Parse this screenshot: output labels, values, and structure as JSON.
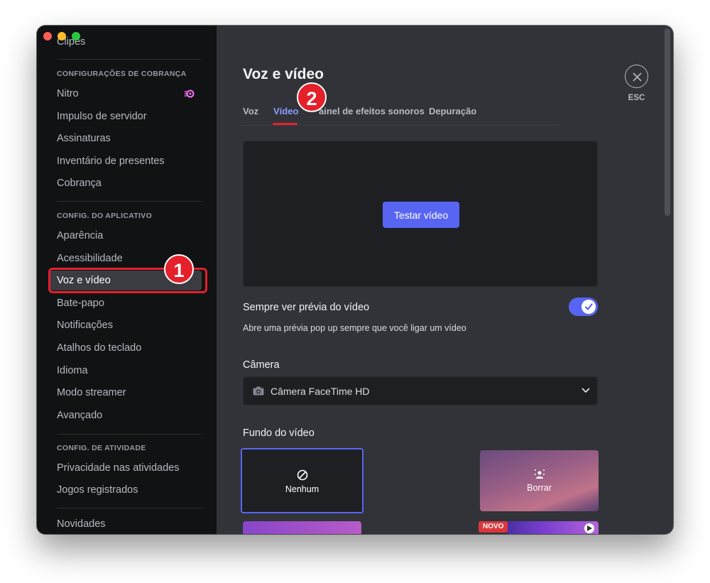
{
  "sidebar": {
    "top_item": "Clipes",
    "sections": [
      {
        "header": "CONFIGURAÇÕES DE COBRANÇA",
        "items": [
          "Nitro",
          "Impulso de servidor",
          "Assinaturas",
          "Inventário de presentes",
          "Cobrança"
        ]
      },
      {
        "header": "CONFIG. DO APLICATIVO",
        "items": [
          "Aparência",
          "Acessibilidade",
          "Voz e vídeo",
          "Bate-papo",
          "Notificações",
          "Atalhos do teclado",
          "Idioma",
          "Modo streamer",
          "Avançado"
        ]
      },
      {
        "header": "CONFIG. DE ATIVIDADE",
        "items": [
          "Privacidade nas atividades",
          "Jogos registrados"
        ]
      }
    ],
    "bottom_item": "Novidades",
    "active_item": "Voz e vídeo"
  },
  "annotations": {
    "step1": "1",
    "step2": "2"
  },
  "main": {
    "title": "Voz e vídeo",
    "tabs": [
      "Voz",
      "Vídeo",
      "ainel de efeitos sonoros",
      "Depuração"
    ],
    "active_tab": "Vídeo",
    "close_label": "ESC",
    "test_button": "Testar vídeo",
    "always_preview": {
      "label": "Sempre ver prévia do vídeo",
      "description": "Abre uma prévia pop up sempre que você ligar um vídeo",
      "enabled": true
    },
    "camera": {
      "label": "Câmera",
      "value": "Câmera FaceTime HD"
    },
    "background": {
      "label": "Fundo do vídeo",
      "options": [
        "Nenhum",
        "Borrar"
      ],
      "selected": "Nenhum",
      "new_badge": "NOVO"
    }
  },
  "colors": {
    "accent": "#5865f2",
    "annotation_red": "#e4202b",
    "sidebar_bg": "#111214",
    "content_bg": "#313338"
  },
  "icons": [
    "search-icon",
    "nitro-icon",
    "close-icon",
    "check-icon",
    "camera-icon",
    "chevron-down-icon",
    "no-background-icon",
    "blur-icon",
    "play-icon"
  ]
}
